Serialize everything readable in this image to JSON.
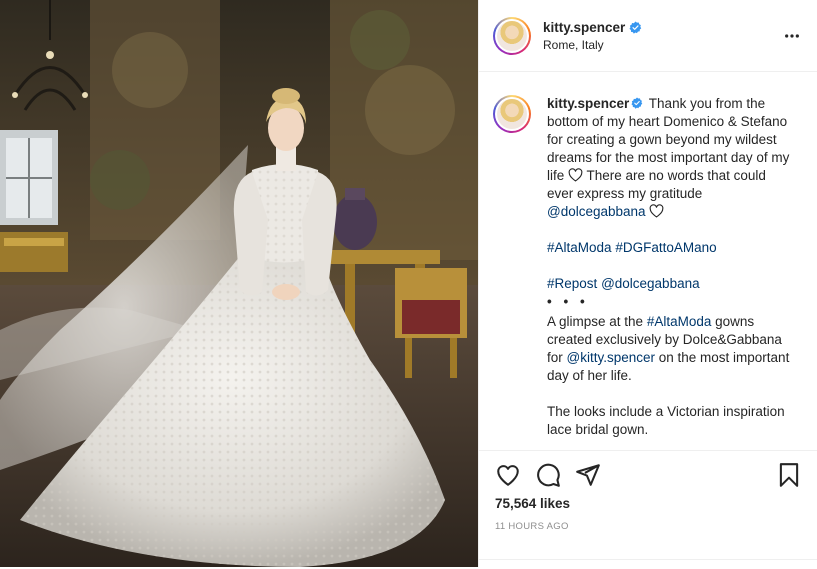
{
  "post": {
    "author": {
      "username": "kitty.spencer",
      "location": "Rome, Italy",
      "verified": true
    },
    "caption": {
      "username": "kitty.spencer",
      "p1_text": " Thank you from the bottom of my heart Domenico & Stefano for creating a gown beyond my wildest dreams for the most important day of my life ",
      "p1_text2": " There are no words that could ever express my gratitude ",
      "p1_mention": "@dolcegabbana",
      "p2_tag1": "#AltaModa",
      "p2_tag2": "#DGFattoAMano",
      "p3_tag": "#Repost",
      "p3_mention": "@dolcegabbana",
      "dots": "• • •",
      "p4_a": "A glimpse at the ",
      "p4_tag": "#AltaModa",
      "p4_b": " gowns created exclusively by Dolce&Gabbana for ",
      "p4_mention": "@kitty.spencer",
      "p4_c": " on the most important day of her life.",
      "p5": "The looks include a Victorian inspiration lace bridal gown."
    },
    "likes": "75,564 likes",
    "timestamp": "11 HOURS AGO",
    "icons": {
      "like": "heart-icon",
      "comment": "comment-icon",
      "share": "share-icon",
      "save": "bookmark-icon",
      "more": "more-options-icon",
      "verified": "verified-badge-icon"
    },
    "colors": {
      "link": "#00376b",
      "verified": "#3897f0",
      "muted": "#8e8e8e",
      "text": "#262626"
    }
  }
}
